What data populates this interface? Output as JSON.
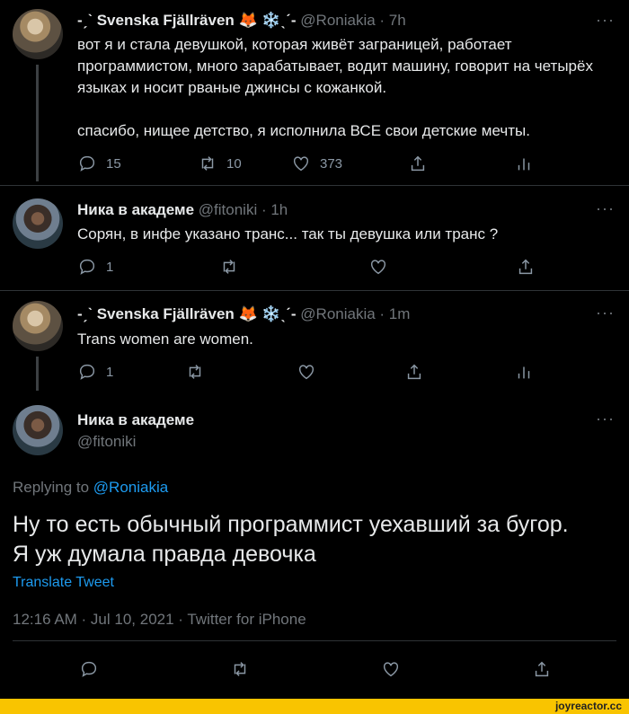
{
  "tweets": [
    {
      "name": "-ˏˋ Svenska Fjällräven 🦊 ❄️ˎˊ-",
      "handle": "@Roniakia · 7h",
      "text": "вот я и стала девушкой, которая живёт заграницей, работает программистом, много зарабатывает, водит машину, говорит на четырёх языках и носит рваные джинсы с кожанкой.\n\nспасибо, нищее детство, я исполнила ВСЕ свои детские мечты.",
      "replies": "15",
      "retweets": "10",
      "likes": "373"
    },
    {
      "name": "Ника в академе",
      "handle": "@fitoniki · 1h",
      "text": "Сорян, в инфе указано транс... так ты девушка или транс ?",
      "replies": "1"
    },
    {
      "name": "-ˏˋ Svenska Fjällräven 🦊 ❄️ˎˊ-",
      "handle": "@Roniakia · 1m",
      "text": "Trans women are women.",
      "replies": "1"
    }
  ],
  "main_tweet": {
    "name": "Ника в академе",
    "handle": "@fitoniki",
    "replying_label": "Replying to",
    "replying_handle": "@Roniakia",
    "text": "Ну то есть обычный программист уехавший за бугор.\nЯ уж думала правда девочка",
    "translate": "Translate Tweet",
    "meta": "12:16 AM · Jul 10, 2021 · Twitter for iPhone"
  },
  "more_label": "···",
  "watermark": "joyreactor.cc",
  "colors": {
    "link": "#1d9bf0",
    "background": "#000000",
    "watermark_bar": "#f9c400"
  }
}
